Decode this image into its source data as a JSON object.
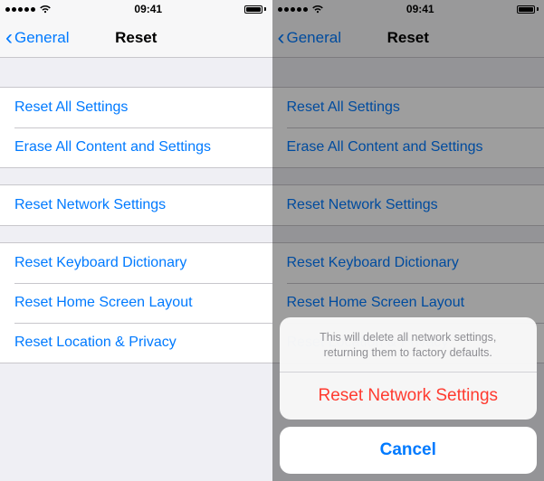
{
  "statusbar": {
    "time": "09:41"
  },
  "nav": {
    "back_label": "General",
    "title": "Reset"
  },
  "groups": {
    "g1": {
      "reset_all": "Reset All Settings",
      "erase_all": "Erase All Content and Settings"
    },
    "g2": {
      "reset_network": "Reset Network Settings"
    },
    "g3": {
      "reset_keyboard": "Reset Keyboard Dictionary",
      "reset_home": "Reset Home Screen Layout",
      "reset_location": "Reset Location & Privacy"
    }
  },
  "sheet": {
    "message": "This will delete all network settings, returning them to factory defaults.",
    "action": "Reset Network Settings",
    "cancel": "Cancel"
  }
}
